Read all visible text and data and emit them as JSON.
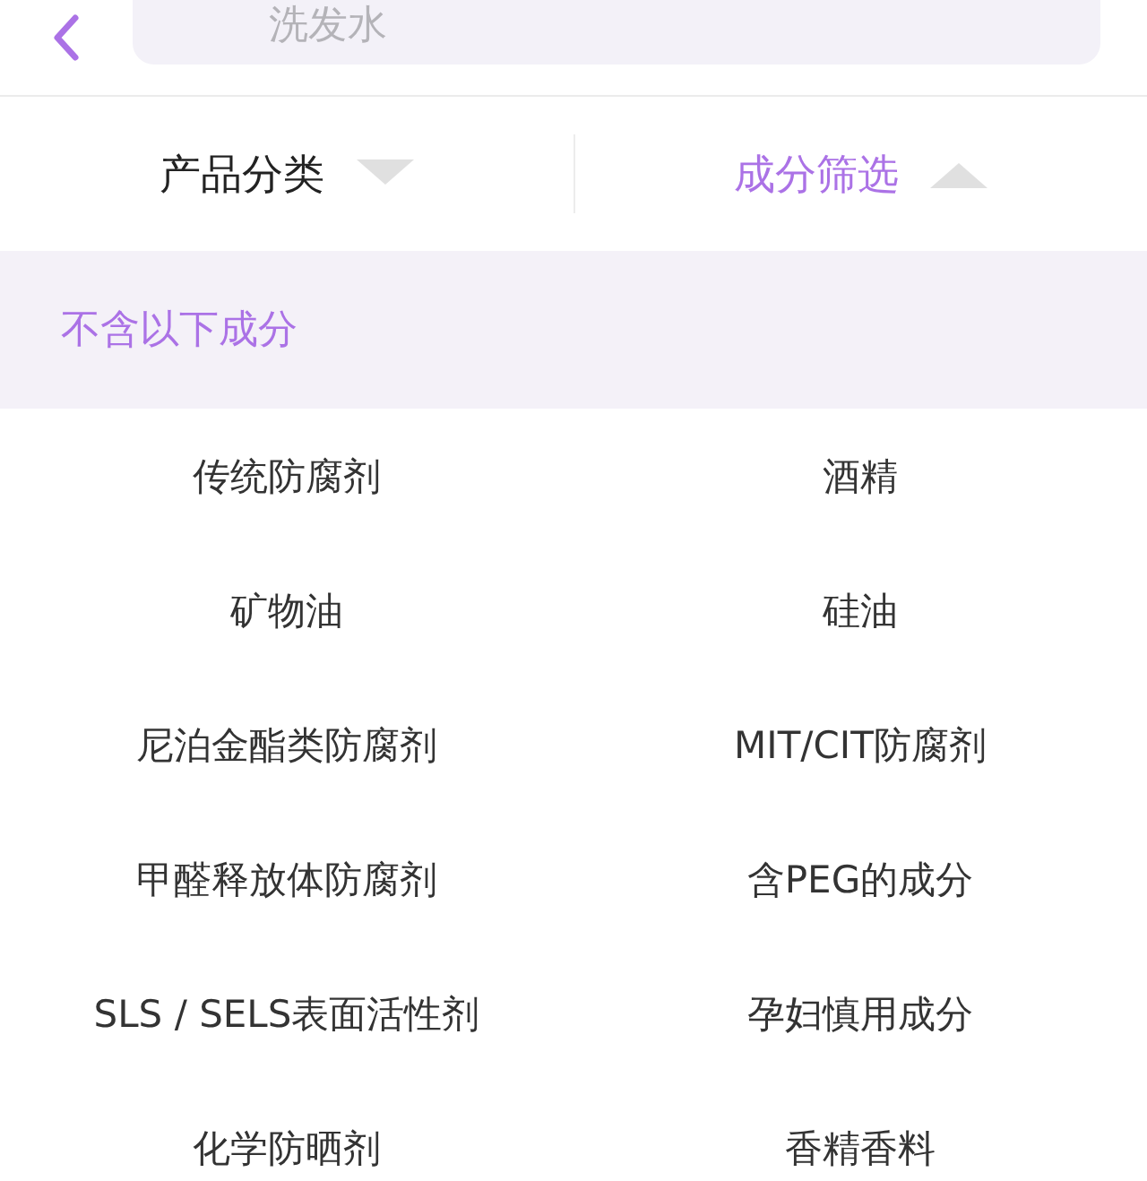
{
  "search": {
    "placeholder": "洗发水"
  },
  "filter_tabs": [
    {
      "label": "产品分类",
      "selected": false
    },
    {
      "label": "成分筛选",
      "selected": true
    }
  ],
  "section": {
    "title": "不含以下成分"
  },
  "options": [
    "传统防腐剂",
    "酒精",
    "矿物油",
    "硅油",
    "尼泊金酯类防腐剂",
    "MIT/CIT防腐剂",
    "甲醛释放体防腐剂",
    "含PEG的成分",
    "SLS / SELS表面活性剂",
    "孕妇慎用成分",
    "化学防晒剂",
    "香精香料"
  ]
}
